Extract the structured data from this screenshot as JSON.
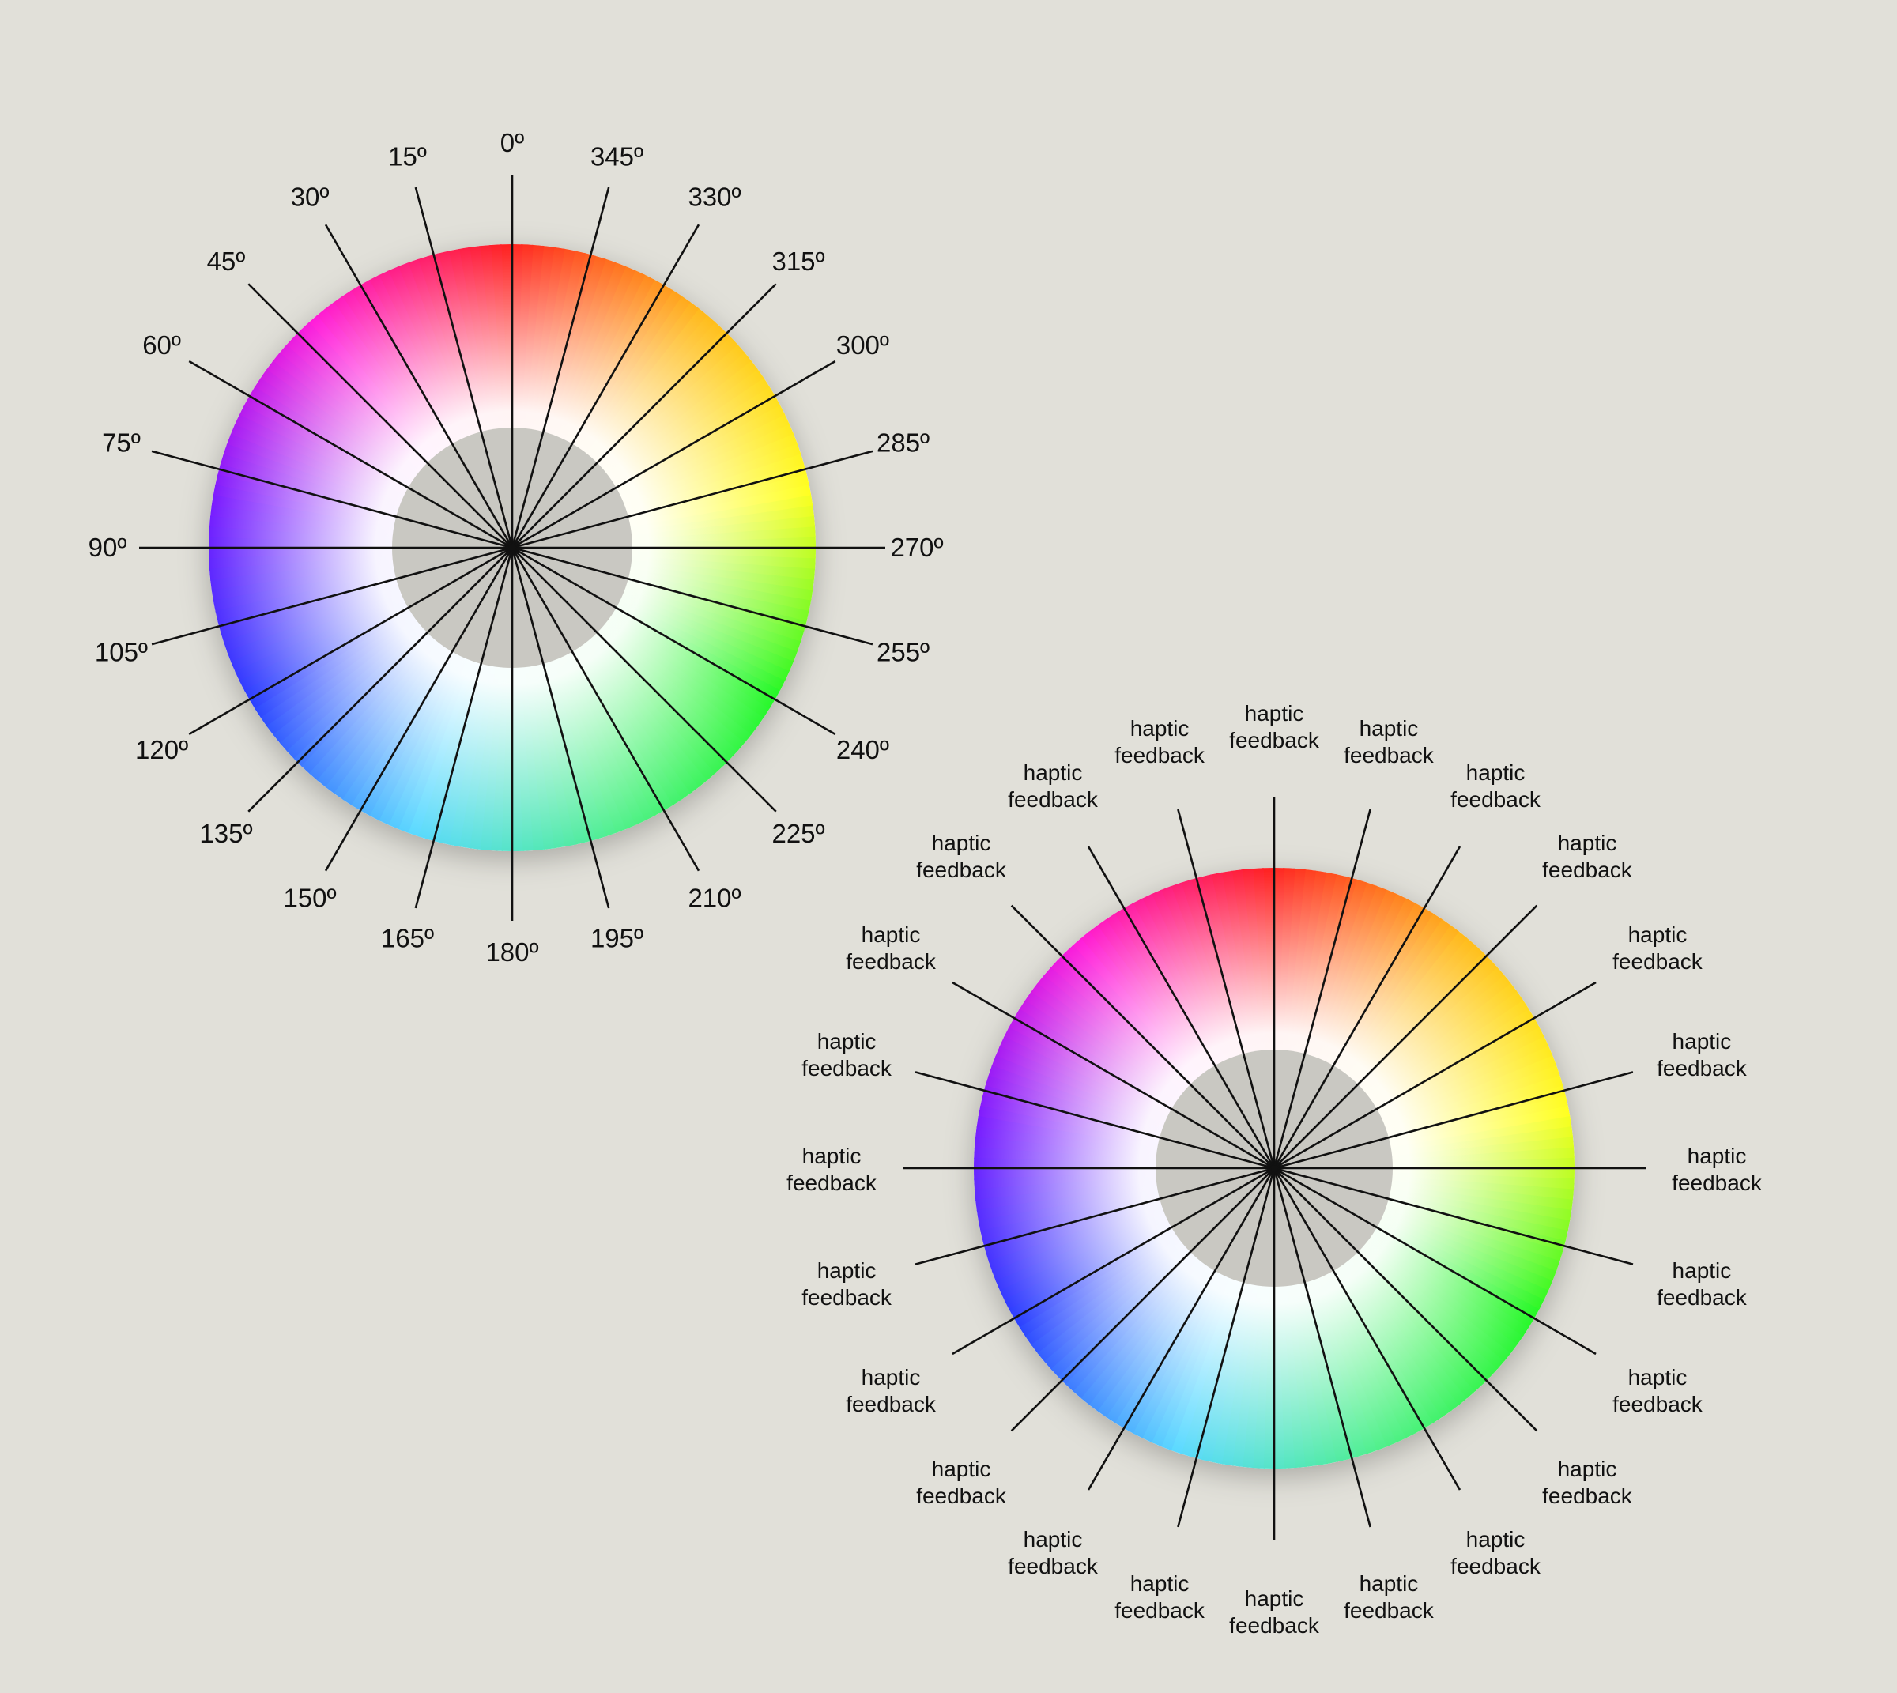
{
  "palette": {
    "background": "#e1e0d9",
    "center_disc": "#c9c8c2",
    "spoke": "#111111",
    "label": "#111111"
  },
  "hue_wheel": {
    "hue_stops": [
      "#ff2020",
      "#ff1bd9",
      "#7a1bff",
      "#2a40ff",
      "#5ad9ff",
      "#4ff08a",
      "#25f825",
      "#ffff20",
      "#ffb91a",
      "#ff2020"
    ],
    "labels": [
      "0º",
      "15º",
      "30º",
      "45º",
      "60º",
      "75º",
      "90º",
      "105º",
      "120º",
      "135º",
      "150º",
      "165º",
      "180º",
      "195º",
      "210º",
      "225º",
      "240º",
      "255º",
      "270º",
      "285º",
      "300º",
      "315º",
      "330º",
      "345º"
    ]
  },
  "haptic_wheel": {
    "label_lines": [
      "haptic",
      "feedback"
    ],
    "count": 24
  }
}
